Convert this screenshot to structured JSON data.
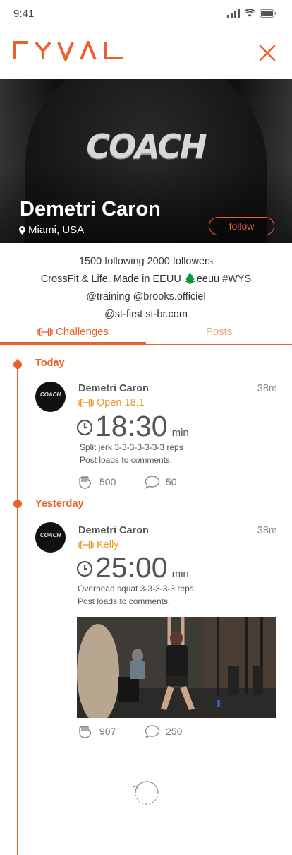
{
  "status_bar": {
    "time": "9:41"
  },
  "header": {
    "logo": "RYVAL"
  },
  "colors": {
    "accent": "#e8622c",
    "workout": "#e89a2c"
  },
  "hero": {
    "shirt_text": "COACH",
    "name": "Demetri Caron",
    "location": "Miami, USA",
    "follow_label": "follow"
  },
  "bio": {
    "line1": "1500 following 2000 followers",
    "line2": "CrossFit & Life. Made in EEUU 🌲eeuu #WYS",
    "line3": "@training @brooks.officiel",
    "line4": "@st-first  st-br.com"
  },
  "tabs": [
    {
      "label": "Challenges",
      "active": true
    },
    {
      "label": "Posts",
      "active": false
    }
  ],
  "timeline": [
    {
      "section": "Today",
      "post": {
        "avatar_text": "COACH",
        "author": "Demetri Caron",
        "time_ago": "38m",
        "workout": "Open 18.1",
        "result": "18:30",
        "unit": "min",
        "desc1": "Split jerk 3-3-3-3-3-3-3 reps",
        "desc2": "Post loads to comments.",
        "likes": "500",
        "comments": "50"
      }
    },
    {
      "section": "Yesterday",
      "post": {
        "avatar_text": "COACH",
        "author": "Demetri Caron",
        "time_ago": "38m",
        "workout": "Kelly",
        "result": "25:00",
        "unit": "min",
        "desc1": "Overhead squat 3-3-3-3-3 reps",
        "desc2": "Post loads to comments.",
        "likes": "907",
        "comments": "250"
      }
    }
  ],
  "icons": [
    "signal-icon",
    "wifi-icon",
    "battery-icon",
    "close-icon",
    "location-pin-icon",
    "barbell-icon",
    "clock-icon",
    "fist-icon",
    "comment-icon",
    "refresh-icon"
  ]
}
